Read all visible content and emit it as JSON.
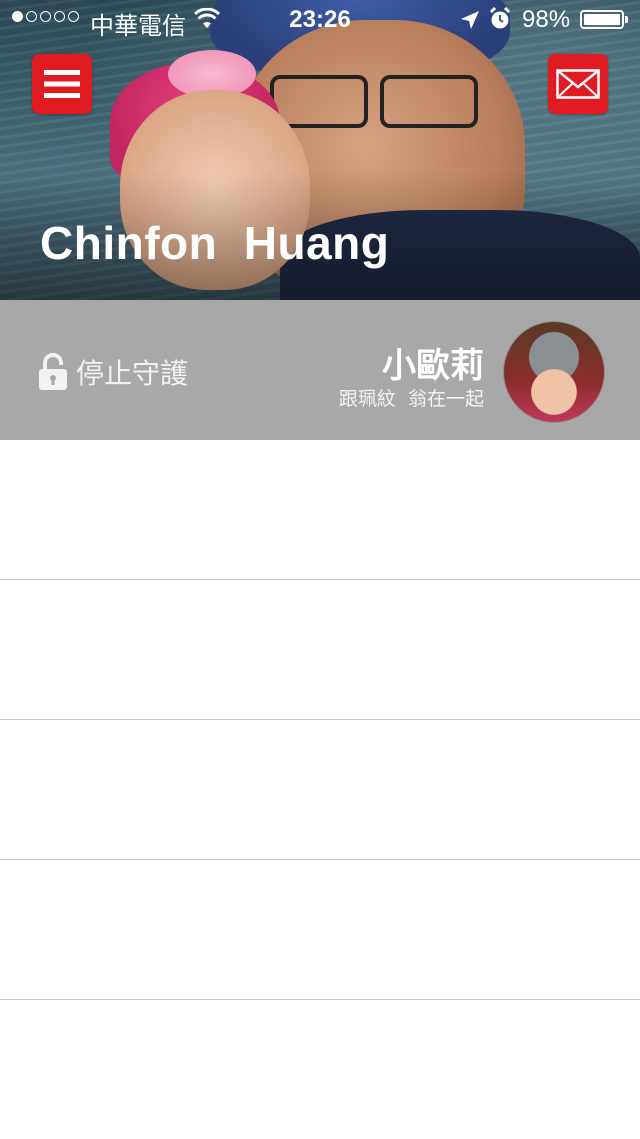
{
  "status_bar": {
    "carrier": "中華電信",
    "time": "23:26",
    "battery": "98%"
  },
  "header": {
    "menu_icon": "hamburger-menu-icon",
    "mail_icon": "envelope-icon",
    "profile_name": "Chinfon  Huang",
    "accent_color": "#e01b22"
  },
  "guard": {
    "lock_icon": "unlocked-padlock-icon",
    "lock_label": "停止守護",
    "child_name": "小歐莉",
    "child_status": "跟珮紋  翁在一起"
  },
  "list": {
    "rows": [
      "",
      "",
      "",
      "",
      ""
    ]
  }
}
